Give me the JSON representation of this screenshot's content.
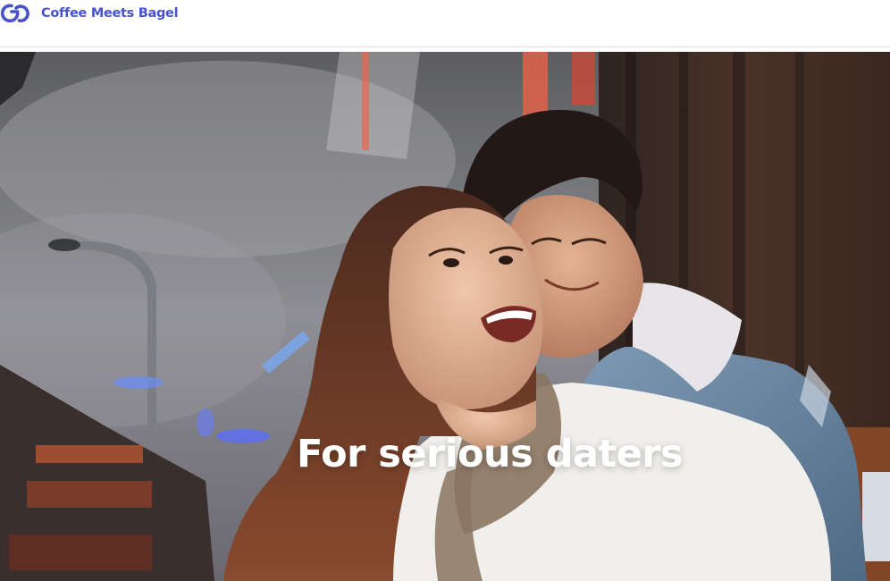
{
  "brand": {
    "name": "Coffee Meets Bagel",
    "color": "#4653cc",
    "logo_icon": "cmb-linked-rings-logo"
  },
  "hero": {
    "headline": "For serious daters",
    "image_description_icon": "couple-photo",
    "headline_color": "#ffffff"
  }
}
